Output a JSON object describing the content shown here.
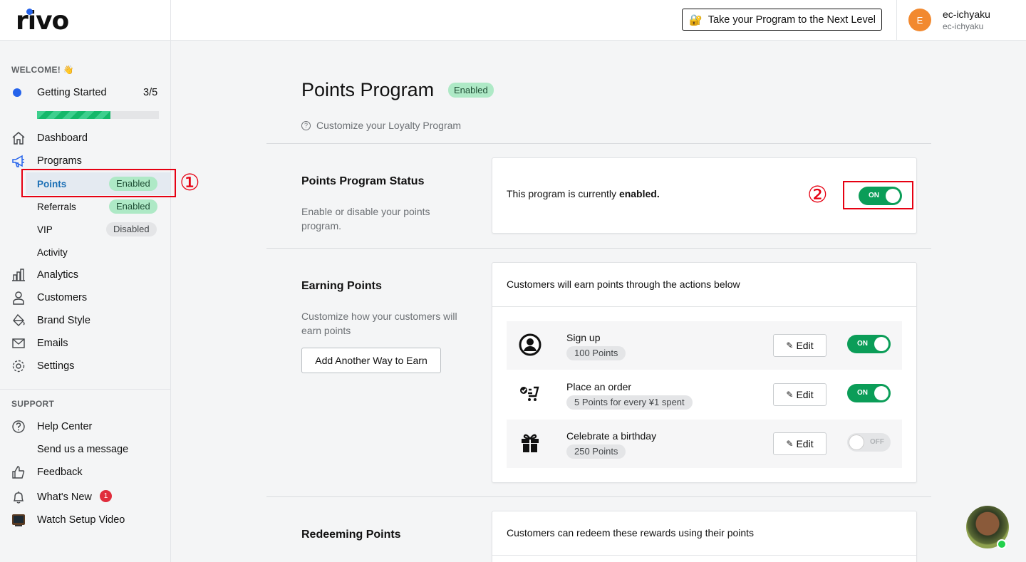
{
  "header": {
    "logo": "rivo",
    "upgrade_label": "Take your Program to the Next Level",
    "avatar_initial": "E",
    "user_name": "ec-ichyaku",
    "user_store": "ec-ichyaku"
  },
  "sidebar": {
    "welcome": "WELCOME! 👋",
    "getting_started": {
      "label": "Getting Started",
      "count": "3/5",
      "progress": 0.6
    },
    "items": {
      "dashboard": "Dashboard",
      "programs": "Programs",
      "points": "Points",
      "points_badge": "Enabled",
      "referrals": "Referrals",
      "referrals_badge": "Enabled",
      "vip": "VIP",
      "vip_badge": "Disabled",
      "activity": "Activity",
      "analytics": "Analytics",
      "customers": "Customers",
      "brand_style": "Brand Style",
      "emails": "Emails",
      "settings": "Settings"
    },
    "support_heading": "SUPPORT",
    "support": {
      "help_center": "Help Center",
      "send_message": "Send us a message",
      "feedback": "Feedback",
      "whats_new": "What's New",
      "whats_new_count": "1",
      "setup_video": "Watch Setup Video"
    }
  },
  "annotations": {
    "marker_1": "①",
    "marker_2": "②"
  },
  "main": {
    "title": "Points Program",
    "title_badge": "Enabled",
    "subtitle": "Customize your Loyalty Program",
    "status_section": {
      "title": "Points Program Status",
      "description": "Enable or disable your points program.",
      "status_prefix": "This program is currently ",
      "status_value": "enabled.",
      "toggle_label": "ON"
    },
    "earning_section": {
      "title": "Earning Points",
      "description": "Customize how your customers will earn points",
      "add_button": "Add Another Way to Earn",
      "card_heading": "Customers will earn points through the actions below",
      "edit_label": "Edit",
      "rows": [
        {
          "name": "Sign up",
          "reward": "100 Points",
          "toggle": "ON"
        },
        {
          "name": "Place an order",
          "reward": "5 Points for every ¥1 spent",
          "toggle": "ON"
        },
        {
          "name": "Celebrate a birthday",
          "reward": "250 Points",
          "toggle": "OFF"
        }
      ]
    },
    "redeeming_section": {
      "title": "Redeeming Points",
      "card_heading": "Customers can redeem these rewards using their points"
    }
  }
}
